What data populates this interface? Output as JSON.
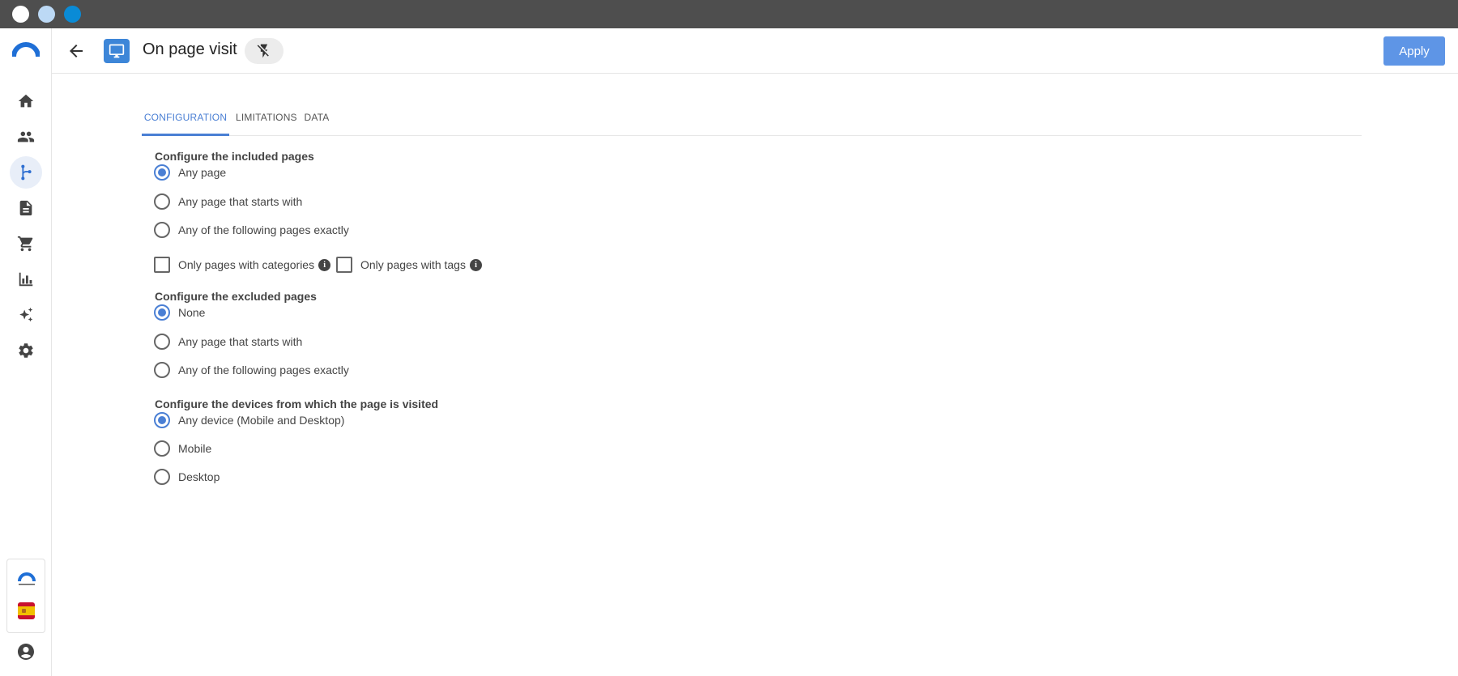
{
  "window": {
    "controls": [
      "close",
      "minimize",
      "maximize"
    ]
  },
  "sidebar": {
    "items": [
      {
        "name": "home",
        "icon": "home-icon"
      },
      {
        "name": "contacts",
        "icon": "people-icon"
      },
      {
        "name": "workflows",
        "icon": "flow-icon",
        "active": true
      },
      {
        "name": "documents",
        "icon": "document-icon"
      },
      {
        "name": "ecommerce",
        "icon": "cart-icon"
      },
      {
        "name": "analytics",
        "icon": "bar-chart-icon"
      },
      {
        "name": "ai",
        "icon": "sparkles-icon"
      },
      {
        "name": "settings",
        "icon": "gear-icon"
      }
    ],
    "language": "es",
    "colors": {
      "active": "#2f6fd1",
      "active_bg": "#e8eef8"
    }
  },
  "header": {
    "title": "On page visit",
    "apply_label": "Apply",
    "accent": "#5e95e6"
  },
  "tabs": [
    {
      "label": "CONFIGURATION",
      "active": true
    },
    {
      "label": "LIMITATIONS",
      "active": false
    },
    {
      "label": "DATA",
      "active": false
    }
  ],
  "included": {
    "title": "Configure the included pages",
    "options": [
      {
        "label": "Any page",
        "checked": true
      },
      {
        "label": "Any page that starts with",
        "checked": false
      },
      {
        "label": "Any of the following pages exactly",
        "checked": false
      }
    ],
    "filters": [
      {
        "label": "Only pages with categories",
        "checked": false
      },
      {
        "label": "Only pages with tags",
        "checked": false
      }
    ]
  },
  "excluded": {
    "title": "Configure the excluded pages",
    "options": [
      {
        "label": "None",
        "checked": true
      },
      {
        "label": "Any page that starts with",
        "checked": false
      },
      {
        "label": "Any of the following pages exactly",
        "checked": false
      }
    ]
  },
  "devices": {
    "title": "Configure the devices from which the page is visited",
    "options": [
      {
        "label": "Any device (Mobile and Desktop)",
        "checked": true
      },
      {
        "label": "Mobile",
        "checked": false
      },
      {
        "label": "Desktop",
        "checked": false
      }
    ]
  }
}
